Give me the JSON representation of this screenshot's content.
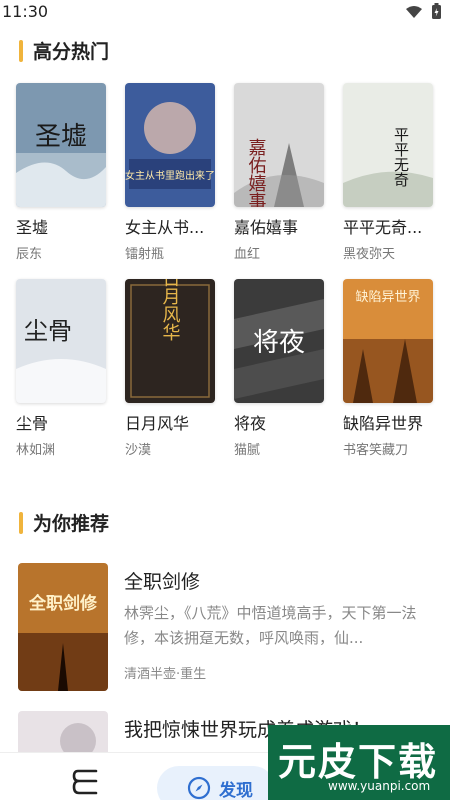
{
  "status_bar": {
    "time": "11:30"
  },
  "sections": {
    "hot": {
      "title": "高分热门"
    },
    "recommend": {
      "title": "为你推荐"
    }
  },
  "hot_books": [
    {
      "title": "圣墟",
      "author": "辰东",
      "cover_text": "圣墟",
      "cover_color": "#7d98b0"
    },
    {
      "title": "女主从书...",
      "author": "镭射瓶",
      "cover_text": "女主从书里跑出来了",
      "cover_color": "#3d5c9c"
    },
    {
      "title": "嘉佑嬉事",
      "author": "血红",
      "cover_text": "嘉佑嬉事",
      "cover_color": "#d9d9d9"
    },
    {
      "title": "平平无奇...",
      "author": "黑夜弥天",
      "cover_text": "平平无奇",
      "cover_color": "#e9ece6"
    },
    {
      "title": "尘骨",
      "author": "林如渊",
      "cover_text": "尘骨",
      "cover_color": "#dfe4ea"
    },
    {
      "title": "日月风华",
      "author": "沙漠",
      "cover_text": "日月风华",
      "cover_color": "#2d2520"
    },
    {
      "title": "将夜",
      "author": "猫腻",
      "cover_text": "将夜",
      "cover_color": "#3b3b3b"
    },
    {
      "title": "缺陷异世界",
      "author": "书客笑藏刀",
      "cover_text": "缺陷异世界",
      "cover_color": "#d98d3a"
    }
  ],
  "recommend": [
    {
      "title": "全职剑修",
      "desc": "林霁尘，《八荒》中悟道境高手，天下第一法修，本该拥趸无数，呼风唤雨，仙...",
      "meta": "清酒半壶·重生",
      "cover_text": "全职剑修",
      "cover_color": "#b8742c"
    },
    {
      "title": "我把惊悚世界玩成养成游戏！",
      "cover_color": "#e8e2e6"
    }
  ],
  "bottom_nav": {
    "shelf_icon": "bookshelf-icon",
    "discover_label": "发现",
    "discover_icon": "compass-icon",
    "me_icon": "profile-icon"
  },
  "watermark": {
    "big": "元皮下载",
    "small": "www.yuanpi.com"
  },
  "colors": {
    "accent": "#f0b43c",
    "nav_active": "#2f6fd0"
  }
}
